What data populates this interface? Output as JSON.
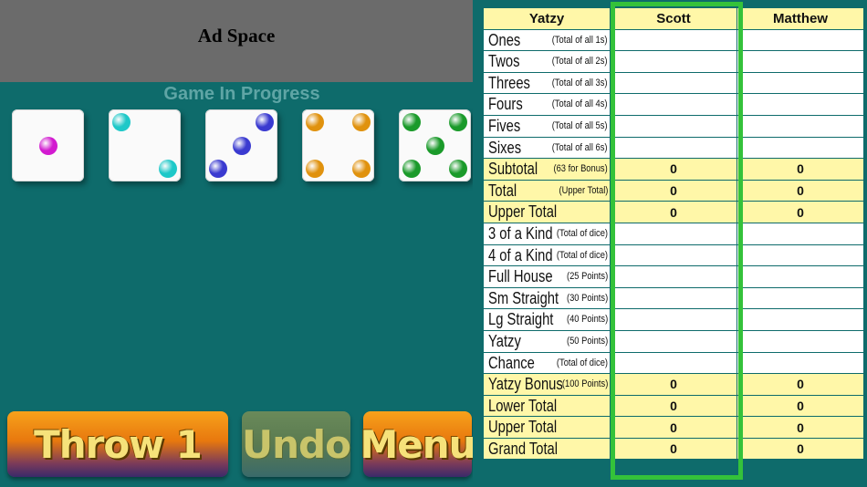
{
  "ad": {
    "label": "Ad Space"
  },
  "status": "Game In Progress",
  "dice": [
    {
      "value": 1,
      "color": "#d21ad0"
    },
    {
      "value": 2,
      "color": "#1ec8c8"
    },
    {
      "value": 3,
      "color": "#3a3ad0"
    },
    {
      "value": 4,
      "color": "#e0920e"
    },
    {
      "value": 5,
      "color": "#1a9a2a"
    }
  ],
  "buttons": {
    "throw": "Throw 1",
    "undo": "Undo",
    "menu": "Menu"
  },
  "scorecard": {
    "header": [
      "Yatzy",
      "Scott",
      "Matthew"
    ],
    "rows": [
      {
        "name": "Ones",
        "hint": "(Total of all 1s)",
        "scott": "",
        "matthew": "",
        "yellow": false
      },
      {
        "name": "Twos",
        "hint": "(Total of all 2s)",
        "scott": "",
        "matthew": "",
        "yellow": false
      },
      {
        "name": "Threes",
        "hint": "(Total of all 3s)",
        "scott": "",
        "matthew": "",
        "yellow": false
      },
      {
        "name": "Fours",
        "hint": "(Total of all 4s)",
        "scott": "",
        "matthew": "",
        "yellow": false
      },
      {
        "name": "Fives",
        "hint": "(Total of all 5s)",
        "scott": "",
        "matthew": "",
        "yellow": false
      },
      {
        "name": "Sixes",
        "hint": "(Total of all 6s)",
        "scott": "",
        "matthew": "",
        "yellow": false
      },
      {
        "name": "Subtotal",
        "hint": "(63 for Bonus)",
        "scott": "0",
        "matthew": "0",
        "yellow": true
      },
      {
        "name": "Total",
        "hint": "(Upper Total)",
        "scott": "0",
        "matthew": "0",
        "yellow": true
      },
      {
        "name": "Upper Total",
        "hint": "",
        "scott": "0",
        "matthew": "0",
        "yellow": true
      },
      {
        "name": "3 of a Kind",
        "hint": "(Total of dice)",
        "scott": "",
        "matthew": "",
        "yellow": false
      },
      {
        "name": "4 of a Kind",
        "hint": "(Total of dice)",
        "scott": "",
        "matthew": "",
        "yellow": false
      },
      {
        "name": "Full House",
        "hint": "(25 Points)",
        "scott": "",
        "matthew": "",
        "yellow": false
      },
      {
        "name": "Sm Straight",
        "hint": "(30 Points)",
        "scott": "",
        "matthew": "",
        "yellow": false
      },
      {
        "name": "Lg Straight",
        "hint": "(40 Points)",
        "scott": "",
        "matthew": "",
        "yellow": false
      },
      {
        "name": "Yatzy",
        "hint": "(50 Points)",
        "scott": "",
        "matthew": "",
        "yellow": false
      },
      {
        "name": "Chance",
        "hint": "(Total of dice)",
        "scott": "",
        "matthew": "",
        "yellow": false
      },
      {
        "name": "Yatzy Bonus",
        "hint": "(100 Points)",
        "scott": "0",
        "matthew": "0",
        "yellow": true
      },
      {
        "name": "Lower Total",
        "hint": "",
        "scott": "0",
        "matthew": "0",
        "yellow": true
      },
      {
        "name": "Upper Total",
        "hint": "",
        "scott": "0",
        "matthew": "0",
        "yellow": true
      },
      {
        "name": "Grand Total",
        "hint": "",
        "scott": "0",
        "matthew": "0",
        "yellow": true
      }
    ]
  }
}
